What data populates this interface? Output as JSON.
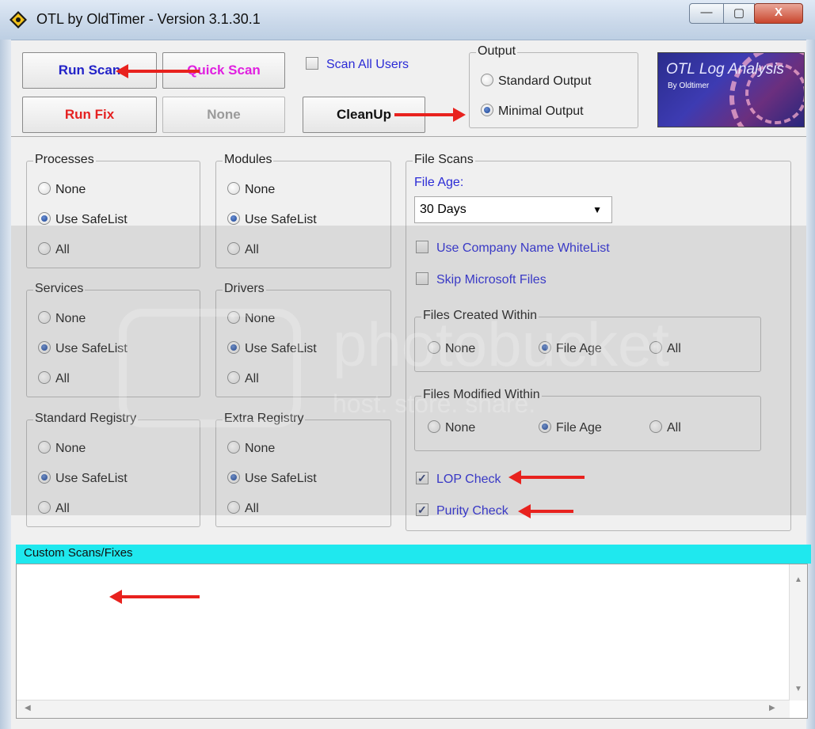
{
  "window": {
    "title": "OTL by OldTimer - Version 3.1.30.1",
    "min_glyph": "—",
    "max_glyph": "▢",
    "close_glyph": "X"
  },
  "toolbar": {
    "run_scan": "Run Scan",
    "quick_scan": "Quick Scan",
    "run_fix": "Run Fix",
    "none": "None",
    "cleanup": "CleanUp",
    "scan_all_users": "Scan All Users"
  },
  "output": {
    "legend": "Output",
    "standard": "Standard Output",
    "minimal": "Minimal Output",
    "selected": "minimal"
  },
  "logo": {
    "title": "OTL Log Analysis",
    "subtitle": "By Oldtimer"
  },
  "groups": {
    "processes": {
      "legend": "Processes",
      "options": [
        "None",
        "Use SafeList",
        "All"
      ],
      "selected": 1
    },
    "modules": {
      "legend": "Modules",
      "options": [
        "None",
        "Use SafeList",
        "All"
      ],
      "selected": 1
    },
    "services": {
      "legend": "Services",
      "options": [
        "None",
        "Use SafeList",
        "All"
      ],
      "selected": 1
    },
    "drivers": {
      "legend": "Drivers",
      "options": [
        "None",
        "Use SafeList",
        "All"
      ],
      "selected": 1
    },
    "standard_registry": {
      "legend": "Standard Registry",
      "options": [
        "None",
        "Use SafeList",
        "All"
      ],
      "selected": 1
    },
    "extra_registry": {
      "legend": "Extra Registry",
      "options": [
        "None",
        "Use SafeList",
        "All"
      ],
      "selected": 1
    }
  },
  "file_scans": {
    "legend": "File Scans",
    "file_age_label": "File Age:",
    "file_age_value": "30 Days",
    "use_company_whitelist": "Use Company Name WhiteList",
    "skip_microsoft": "Skip Microsoft Files",
    "created_within": {
      "legend": "Files Created Within",
      "options": [
        "None",
        "File Age",
        "All"
      ],
      "selected": 1
    },
    "modified_within": {
      "legend": "Files Modified Within",
      "options": [
        "None",
        "File Age",
        "All"
      ],
      "selected": 1
    },
    "lop_check": "LOP Check",
    "purity_check": "Purity Check",
    "lop_checked": true,
    "purity_checked": true
  },
  "custom": {
    "label": "Custom Scans/Fixes"
  },
  "watermark": {
    "text": "photobucket",
    "sub": "host. store. share."
  },
  "colors": {
    "run_scan": "#2323c8",
    "quick_scan": "#e020e0",
    "run_fix": "#e52222",
    "arrow": "#e8221e",
    "custom_bar": "#1fe8ee",
    "link_text": "#2b2bd6"
  }
}
